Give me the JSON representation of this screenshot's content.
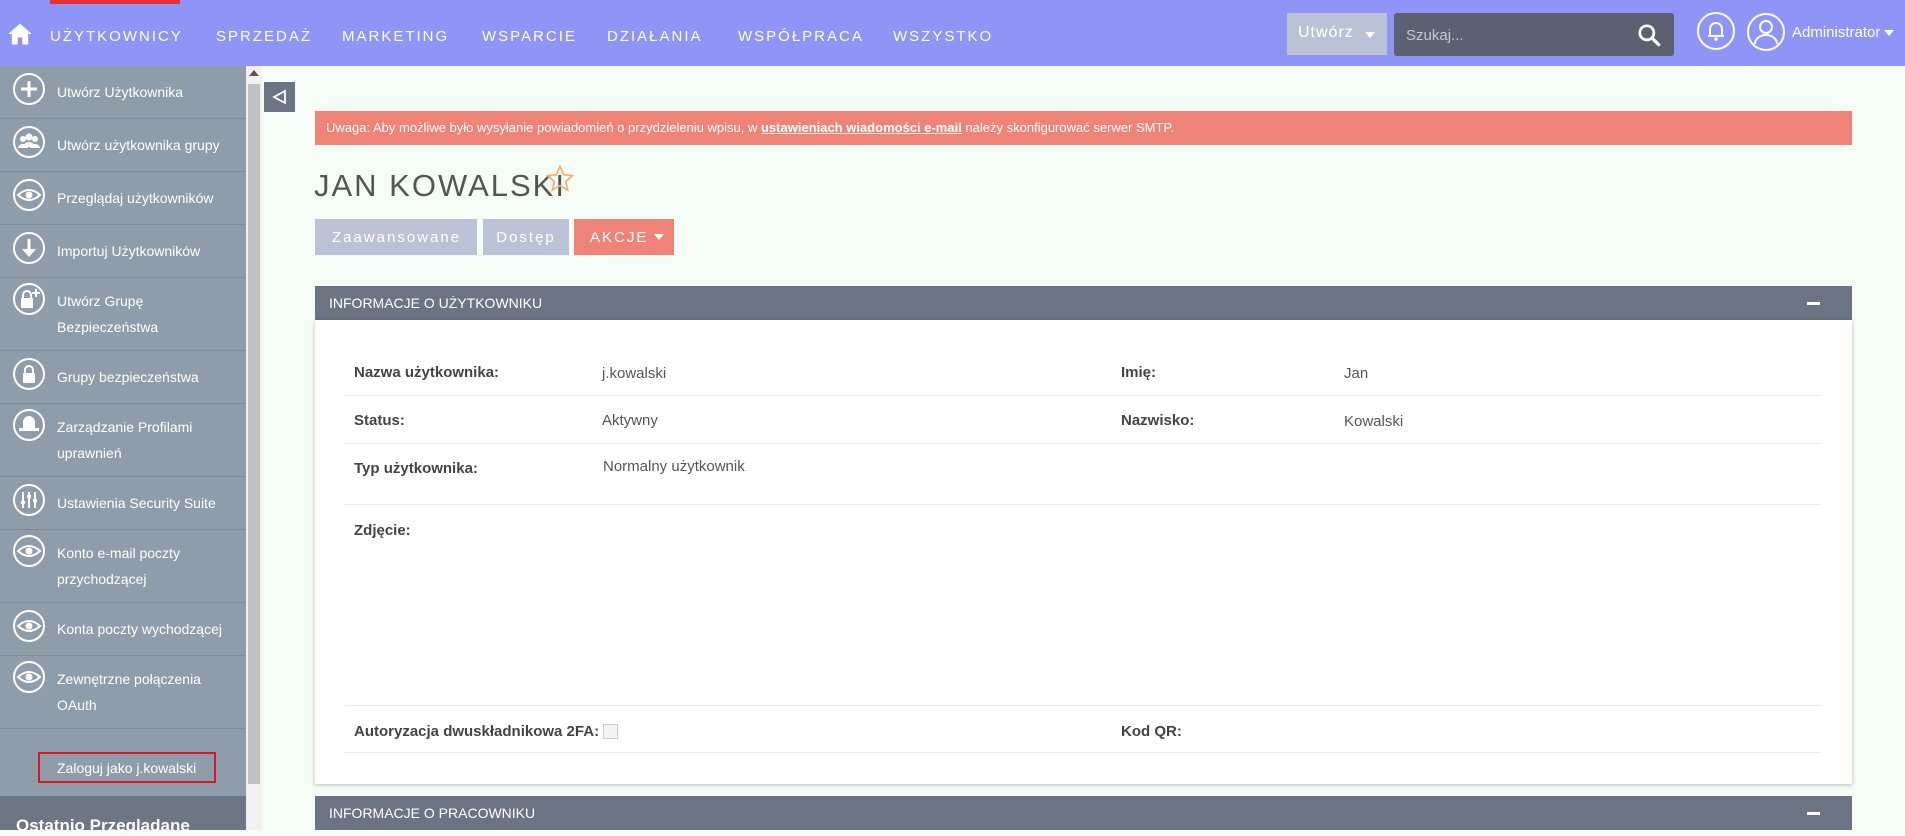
{
  "nav": {
    "items": [
      "Użytkownicy",
      "Sprzedaż",
      "Marketing",
      "Wsparcie",
      "Działania",
      "Współpraca",
      "Wszystko"
    ],
    "create_label": "Utwórz",
    "search_placeholder": "Szukaj...",
    "user_name": "Administrator"
  },
  "sidebar": {
    "items": [
      {
        "label": "Utwórz Użytkownika",
        "icon": "plus-circle-icon"
      },
      {
        "label": "Utwórz użytkownika grupy",
        "icon": "group-icon"
      },
      {
        "label": "Przeglądaj użytkowników",
        "icon": "eye-icon"
      },
      {
        "label": "Importuj Użytkowników",
        "icon": "import-icon"
      },
      {
        "label": "Utwórz Grupę Bezpieczeństwa",
        "icon": "lock-plus-icon"
      },
      {
        "label": "Grupy bezpieczeństwa",
        "icon": "lock-icon"
      },
      {
        "label": "Zarządzanie Profilami uprawnień",
        "icon": "hat-icon"
      },
      {
        "label": "Ustawienia Security Suite",
        "icon": "sliders-icon"
      },
      {
        "label": "Konto e-mail poczty przychodzącej",
        "icon": "eye-icon"
      },
      {
        "label": "Konta poczty wychodzącej",
        "icon": "eye-icon"
      },
      {
        "label": "Zewnętrzne połączenia OAuth",
        "icon": "eye-icon"
      }
    ],
    "login_as": "Zaloguj jako j.kowalski",
    "recent_title": "Ostatnio Przeglądane"
  },
  "alert": {
    "prefix": "Uwaga: Aby możliwe było wysyłanie powiadomień o przydzieleniu wpisu, w ",
    "link": "ustawieniach wiadomości e-mail",
    "suffix": " należy skonfigurować serwer SMTP."
  },
  "record": {
    "title": "JAN KOWALSKI"
  },
  "tabs": {
    "advanced": "Zaawansowane",
    "access": "Dostęp",
    "actions": "AKCJE"
  },
  "panel_user": {
    "title": "INFORMACJE O UŻYTKOWNIKU",
    "username_label": "Nazwa użytkownika:",
    "username_value": "j.kowalski",
    "first_name_label": "Imię:",
    "first_name_value": "Jan",
    "status_label": "Status:",
    "status_value": "Aktywny",
    "last_name_label": "Nazwisko:",
    "last_name_value": "Kowalski",
    "user_type_label": "Typ użytkownika:",
    "user_type_value": "Normalny użytkownik",
    "photo_label": "Zdjęcie:",
    "twofa_label": "Autoryzacja dwuskładnikowa 2FA:",
    "qr_label": "Kod QR:"
  },
  "panel_employee": {
    "title": "INFORMACJE O PRACOWNIKU"
  }
}
